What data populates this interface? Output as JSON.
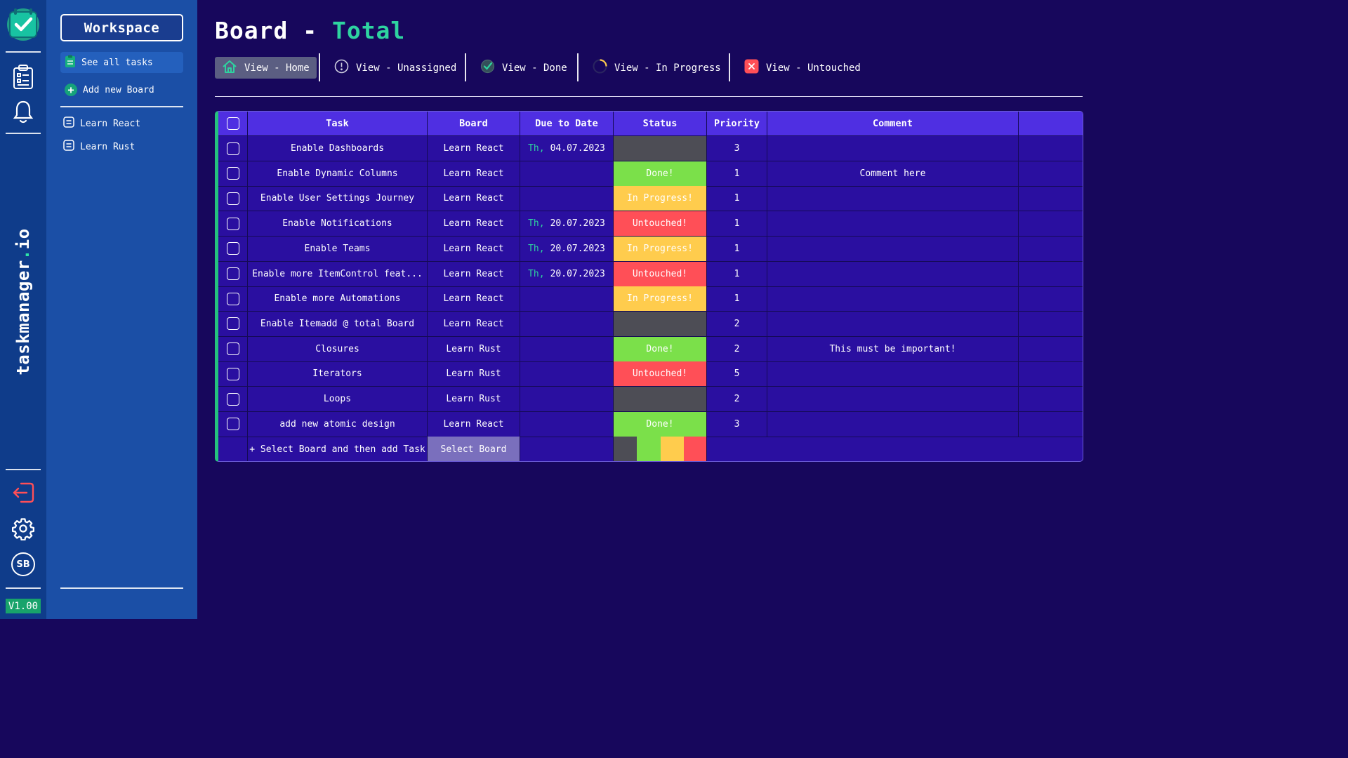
{
  "app": {
    "brand_prefix": "taskmanager",
    "brand_dot": ".",
    "brand_suffix": "io",
    "version": "V1.00",
    "avatar_initials": "SB"
  },
  "sidebar": {
    "workspace_label": "Workspace",
    "see_all_label": "See all tasks",
    "add_board_label": "Add new Board",
    "boards": [
      {
        "label": "Learn React"
      },
      {
        "label": "Learn Rust"
      }
    ]
  },
  "header": {
    "title_prefix": "Board - ",
    "title_accent": "Total"
  },
  "views": [
    {
      "label": "View - Home",
      "icon": "home-icon"
    },
    {
      "label": "View - Unassigned",
      "icon": "exclamation-circle-icon"
    },
    {
      "label": "View - Done",
      "icon": "check-circle-icon"
    },
    {
      "label": "View - In Progress",
      "icon": "progress-spinner-icon"
    },
    {
      "label": "View - Untouched",
      "icon": "x-square-icon"
    }
  ],
  "table": {
    "columns": {
      "task": "Task",
      "board": "Board",
      "due": "Due to Date",
      "status": "Status",
      "priority": "Priority",
      "comment": "Comment"
    },
    "rows": [
      {
        "task": "Enable Dashboards",
        "board": "Learn React",
        "due_day": "Th,",
        "due_date": "04.07.2023",
        "status": "",
        "priority": "3",
        "comment": ""
      },
      {
        "task": "Enable Dynamic Columns",
        "board": "Learn React",
        "due_day": "",
        "due_date": "",
        "status": "Done!",
        "priority": "1",
        "comment": "Comment here"
      },
      {
        "task": "Enable User Settings Journey",
        "board": "Learn React",
        "due_day": "",
        "due_date": "",
        "status": "In Progress!",
        "priority": "1",
        "comment": ""
      },
      {
        "task": "Enable Notifications",
        "board": "Learn React",
        "due_day": "Th,",
        "due_date": "20.07.2023",
        "status": "Untouched!",
        "priority": "1",
        "comment": ""
      },
      {
        "task": "Enable Teams",
        "board": "Learn React",
        "due_day": "Th,",
        "due_date": "20.07.2023",
        "status": "In Progress!",
        "priority": "1",
        "comment": ""
      },
      {
        "task": "Enable more ItemControl feat...",
        "board": "Learn React",
        "due_day": "Th,",
        "due_date": "20.07.2023",
        "status": "Untouched!",
        "priority": "1",
        "comment": ""
      },
      {
        "task": "Enable more Automations",
        "board": "Learn React",
        "due_day": "",
        "due_date": "",
        "status": "In Progress!",
        "priority": "1",
        "comment": ""
      },
      {
        "task": "Enable Itemadd @ total Board",
        "board": "Learn React",
        "due_day": "",
        "due_date": "",
        "status": "",
        "priority": "2",
        "comment": ""
      },
      {
        "task": "Closures",
        "board": "Learn Rust",
        "due_day": "",
        "due_date": "",
        "status": "Done!",
        "priority": "2",
        "comment": "This must be important!"
      },
      {
        "task": "Iterators",
        "board": "Learn Rust",
        "due_day": "",
        "due_date": "",
        "status": "Untouched!",
        "priority": "5",
        "comment": ""
      },
      {
        "task": "Loops",
        "board": "Learn Rust",
        "due_day": "",
        "due_date": "",
        "status": "",
        "priority": "2",
        "comment": ""
      },
      {
        "task": "add new atomic design",
        "board": "Learn React",
        "due_day": "",
        "due_date": "",
        "status": "Done!",
        "priority": "3",
        "comment": ""
      }
    ],
    "footer": {
      "add_task_label": "+ Select Board and then add Task",
      "select_board_label": "Select Board"
    }
  },
  "colors": {
    "status_done": "#7be04a",
    "status_in_progress": "#ffcc4d",
    "status_untouched": "#ff4f57",
    "status_empty": "#4d4d55",
    "accent": "#2ed3a0",
    "background": "#17075c"
  }
}
